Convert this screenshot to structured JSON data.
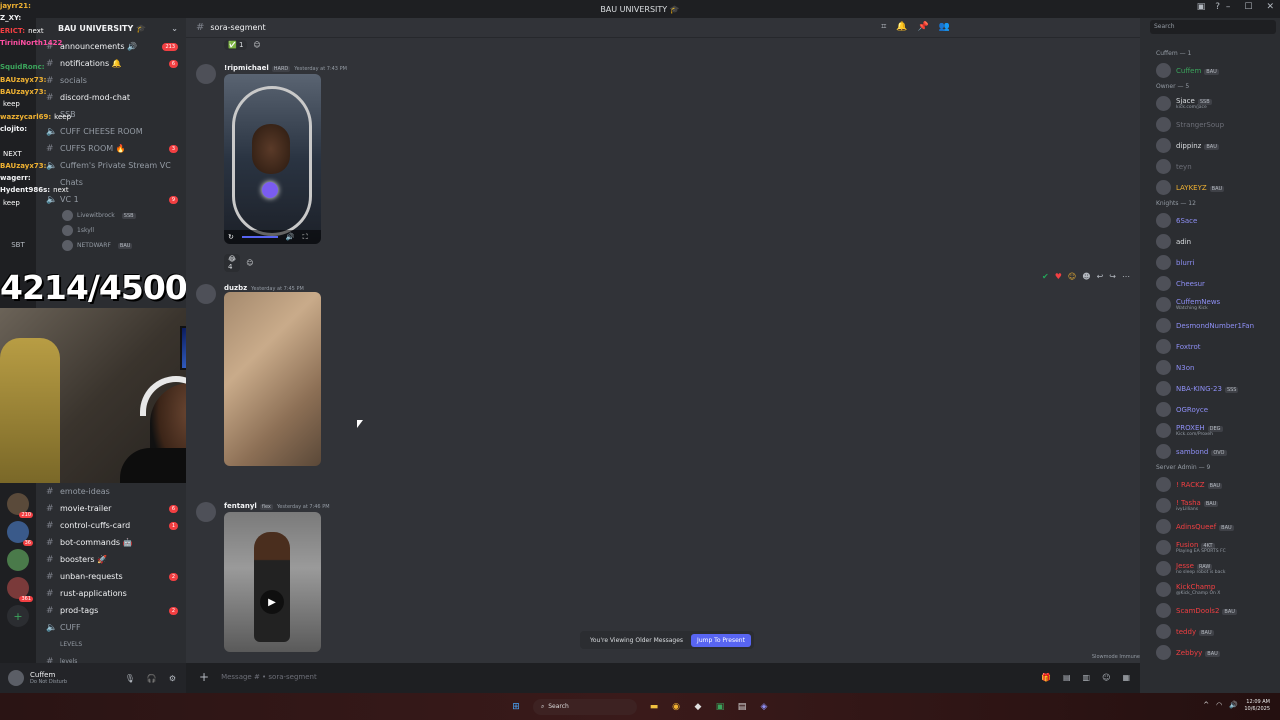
{
  "window": {
    "title": "BAU UNIVERSITY 🎓"
  },
  "server": {
    "name": "BAU UNIVERSITY 🎓"
  },
  "channels": [
    {
      "label": "announcements 🔊",
      "badge": "213",
      "bright": true
    },
    {
      "label": "notifications 🔔",
      "badge": "6",
      "bright": true
    },
    {
      "label": "socials",
      "badge": "",
      "bright": false
    },
    {
      "label": "discord-mod-chat",
      "badge": "",
      "bright": true
    },
    {
      "label": "SSB",
      "badge": "",
      "bright": false
    },
    {
      "label": "CUFF CHEESE ROOM",
      "badge": "",
      "bright": false
    },
    {
      "label": "CUFFS ROOM 🔥",
      "badge": "3",
      "bright": false
    },
    {
      "label": "Cuffem's Private Stream VC",
      "badge": "",
      "bright": false
    },
    {
      "label": "Chats",
      "badge": "",
      "bright": false
    },
    {
      "label": "VC 1",
      "badge": "9",
      "bright": false
    }
  ],
  "voice_users": [
    {
      "name": "Livewitbrock",
      "tag": "SSB"
    },
    {
      "name": "1skyll",
      "tag": ""
    },
    {
      "name": "NETDWARF",
      "tag": "BAU"
    }
  ],
  "lower_channels": [
    {
      "label": "emote-ideas",
      "badge": ""
    },
    {
      "label": "movie-trailer",
      "badge": "6"
    },
    {
      "label": "control-cuffs-card",
      "badge": "1"
    },
    {
      "label": "bot-commands 🤖",
      "badge": ""
    },
    {
      "label": "boosters 🚀",
      "badge": ""
    },
    {
      "label": "unban-requests",
      "badge": "2"
    },
    {
      "label": "rust-applications",
      "badge": ""
    },
    {
      "label": "prod-tags",
      "badge": "2"
    },
    {
      "label": "CUFF",
      "badge": ""
    },
    {
      "label": "LEVELS",
      "badge": ""
    },
    {
      "label": "levels",
      "badge": ""
    }
  ],
  "rail": {
    "items": [
      {
        "label": "SBT",
        "badge": ""
      },
      {
        "label": "",
        "badge": "210"
      },
      {
        "label": "",
        "badge": "36"
      },
      {
        "label": "",
        "badge": "361"
      }
    ]
  },
  "stream_overlay": {
    "chat": [
      {
        "user": "jayrr21:",
        "text": "",
        "color": "#f0b232"
      },
      {
        "user": "Z_XY:",
        "text": "",
        "color": "#f2f3f5"
      },
      {
        "user": "ERICT:",
        "text": "next",
        "color": "#f23f42"
      },
      {
        "user": "TiriniNorth1422",
        "text": "",
        "color": "#ff4fa3"
      },
      {
        "user": "",
        "text": "",
        "color": "#f2f3f5"
      },
      {
        "user": "SquidRonc:",
        "text": "",
        "color": "#3ba55c"
      },
      {
        "user": "BAUzayx73:",
        "text": "",
        "color": "#f0b232"
      },
      {
        "user": "BAUzayx73:",
        "text": "",
        "color": "#f0b232"
      },
      {
        "user": "",
        "text": "keep",
        "color": "#f2f3f5"
      },
      {
        "user": "wazzycarl69:",
        "text": "keep",
        "color": "#f0b232"
      },
      {
        "user": "clojito:",
        "text": "",
        "color": "#f2f3f5"
      },
      {
        "user": "",
        "text": "",
        "color": "#f2f3f5"
      },
      {
        "user": "",
        "text": "NEXT",
        "color": "#f2f3f5"
      },
      {
        "user": "BAUzayx73:",
        "text": "",
        "color": "#f0b232"
      },
      {
        "user": "wagerr:",
        "text": "",
        "color": "#f2f3f5"
      },
      {
        "user": "Hydent986s:",
        "text": "next",
        "color": "#f2f3f5"
      },
      {
        "user": "",
        "text": "keep",
        "color": "#f2f3f5"
      }
    ],
    "counter": "4214/4500"
  },
  "main": {
    "channel_name": "sora-segment",
    "messages": [
      {
        "name": "!ripmichael",
        "tag": "HARD",
        "timestamp": "Yesterday at 7:43 PM",
        "reaction": "4"
      },
      {
        "name": "duzbz",
        "tag": "",
        "timestamp": "Yesterday at 7:45 PM"
      },
      {
        "name": "fentanyl",
        "tag": "flex",
        "timestamp": "Yesterday at 7:46 PM"
      }
    ],
    "older_notice": "You're Viewing Older Messages",
    "jump_label": "Jump To Present",
    "slowmode": "Slowmode Immune",
    "composer_placeholder": "Message # • sora-segment",
    "top_reaction": "1"
  },
  "user_panel": {
    "name": "Cuffem",
    "status": "Do Not Disturb"
  },
  "members": {
    "search_placeholder": "Search",
    "groups": [
      {
        "title": "Cuffem — 1",
        "members": [
          {
            "name": "Cuffem",
            "tag": "BAU",
            "color": "#3ba55c",
            "sub": ""
          }
        ]
      },
      {
        "title": "Owner — 5",
        "members": [
          {
            "name": "Sjace",
            "tag": "SSB",
            "color": "#dbdee1",
            "sub": "kick.com/jace"
          },
          {
            "name": "StrangerSoup",
            "tag": "",
            "color": "#6d6f78",
            "sub": ""
          },
          {
            "name": "dippinz",
            "tag": "BAU",
            "color": "#dbdee1",
            "sub": ""
          },
          {
            "name": "teyn",
            "tag": "",
            "color": "#6d6f78",
            "sub": ""
          },
          {
            "name": "LAYKEYZ",
            "tag": "BAU",
            "color": "#f0b232",
            "sub": ""
          }
        ]
      },
      {
        "title": "Knights — 12",
        "members": [
          {
            "name": "6Sace",
            "tag": "",
            "color": "#8e8ff5",
            "sub": ""
          },
          {
            "name": "adin",
            "tag": "",
            "color": "#dbdee1",
            "sub": ""
          },
          {
            "name": "blurri",
            "tag": "",
            "color": "#8e8ff5",
            "sub": ""
          },
          {
            "name": "Cheesur",
            "tag": "",
            "color": "#8e8ff5",
            "sub": ""
          },
          {
            "name": "CuffemNews",
            "tag": "",
            "color": "#8e8ff5",
            "sub": "Watching Kick"
          },
          {
            "name": "DesmondNumber1Fan",
            "tag": "",
            "color": "#8e8ff5",
            "sub": ""
          },
          {
            "name": "Foxtrot",
            "tag": "",
            "color": "#8e8ff5",
            "sub": ""
          },
          {
            "name": "N3on",
            "tag": "",
            "color": "#8e8ff5",
            "sub": ""
          },
          {
            "name": "NBA-KING-23",
            "tag": "SSS",
            "color": "#8e8ff5",
            "sub": ""
          },
          {
            "name": "OGRoyce",
            "tag": "",
            "color": "#8e8ff5",
            "sub": ""
          },
          {
            "name": "PROXEH",
            "tag": "DEG",
            "color": "#8e8ff5",
            "sub": "Kick.com/Proxeh"
          },
          {
            "name": "sambond",
            "tag": "OVO",
            "color": "#8e8ff5",
            "sub": ""
          }
        ]
      },
      {
        "title": "Server Admin — 9",
        "members": [
          {
            "name": "! RACKZ",
            "tag": "BAU",
            "color": "#f23f42",
            "sub": ""
          },
          {
            "name": "! Tasha",
            "tag": "BAU",
            "color": "#f23f42",
            "sub": "ivyLillians"
          },
          {
            "name": "AdinsQueef",
            "tag": "BAU",
            "color": "#f23f42",
            "sub": ""
          },
          {
            "name": "Fusion",
            "tag": "4KT",
            "color": "#f23f42",
            "sub": "Playing EA SPORTS FC"
          },
          {
            "name": "Jesse",
            "tag": "RAW",
            "color": "#f23f42",
            "sub": "no sleep robot is back"
          },
          {
            "name": "KickChamp",
            "tag": "",
            "color": "#f23f42",
            "sub": "@Kick_Champ On X"
          },
          {
            "name": "ScamDools2",
            "tag": "BAU",
            "color": "#f23f42",
            "sub": ""
          },
          {
            "name": "teddy",
            "tag": "BAU",
            "color": "#f23f42",
            "sub": ""
          },
          {
            "name": "Zebbyy",
            "tag": "BAU",
            "color": "#f23f42",
            "sub": ""
          }
        ]
      }
    ]
  },
  "taskbar": {
    "search_label": "Search",
    "time": "12:09 AM",
    "date": "10/6/2025"
  }
}
